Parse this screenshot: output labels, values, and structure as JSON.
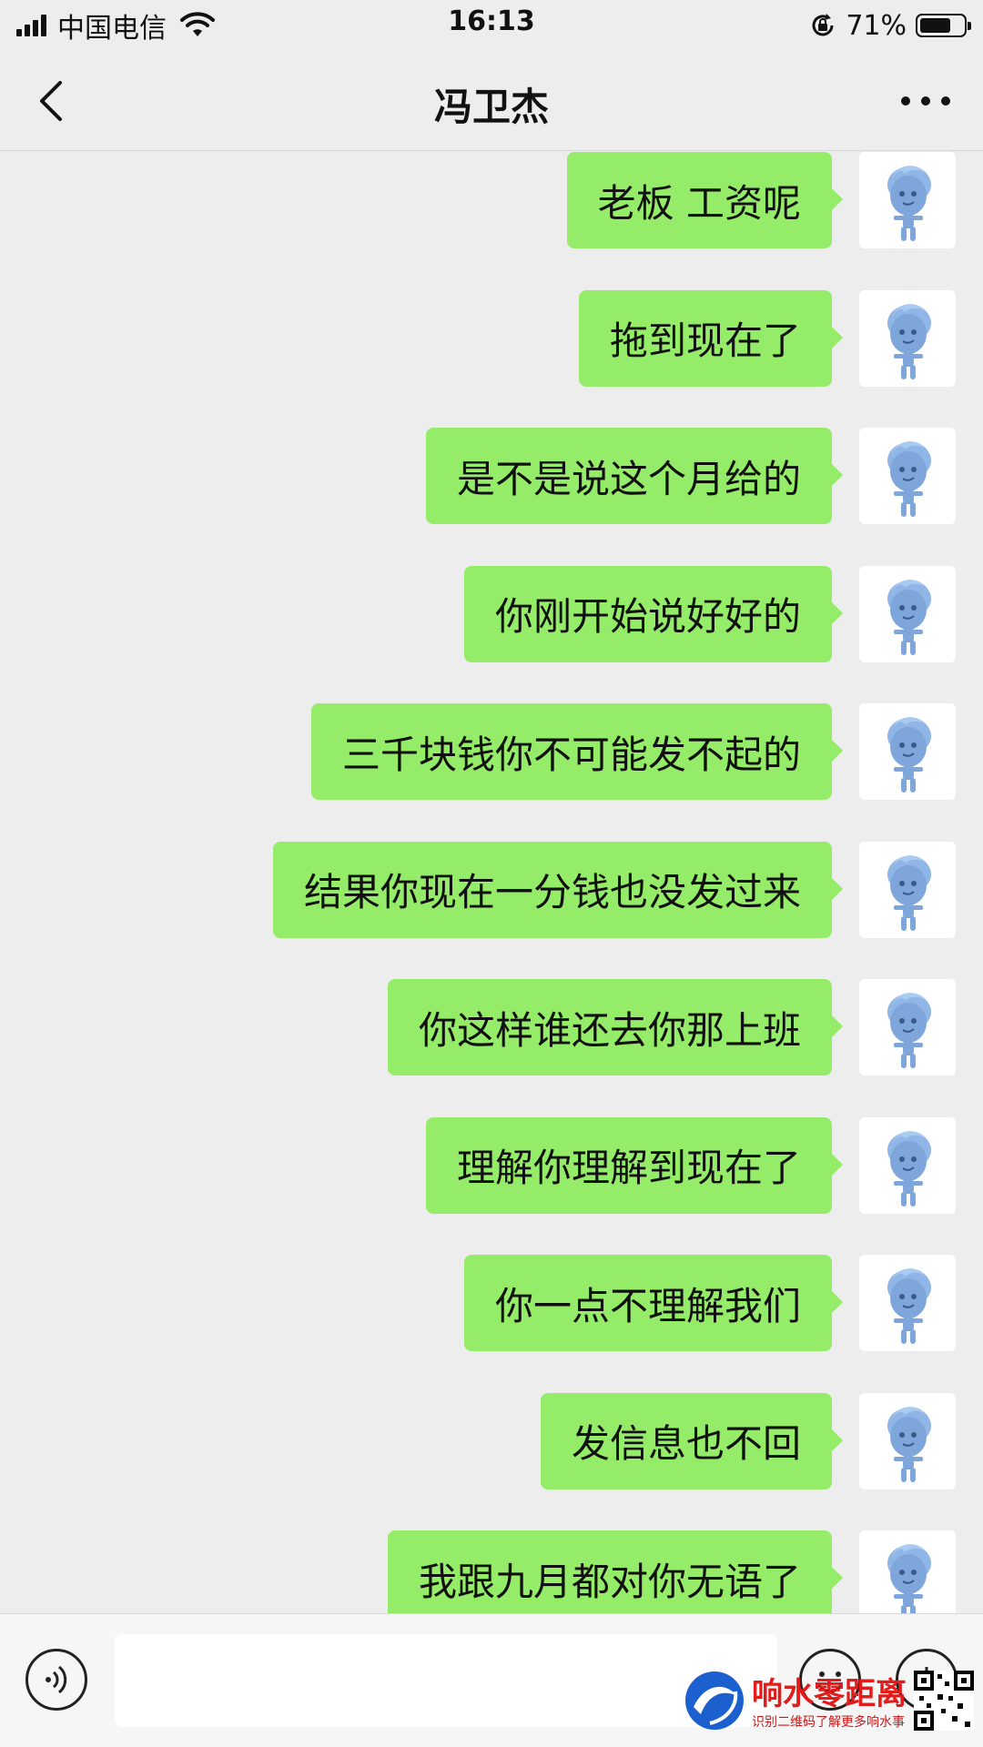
{
  "status_bar": {
    "carrier": "中国电信",
    "time": "16:13",
    "battery_percent": "71%",
    "battery_level": 0.71
  },
  "header": {
    "title": "冯卫杰",
    "back_icon": "chevron-left-icon",
    "more_icon": "more-dots-icon"
  },
  "messages": [
    {
      "text": "老板 工资呢",
      "sender": "me"
    },
    {
      "text": "拖到现在了",
      "sender": "me"
    },
    {
      "text": "是不是说这个月给的",
      "sender": "me"
    },
    {
      "text": "你刚开始说好好的",
      "sender": "me"
    },
    {
      "text": "三千块钱你不可能发不起的",
      "sender": "me"
    },
    {
      "text": "结果你现在一分钱也没发过来",
      "sender": "me"
    },
    {
      "text": "你这样谁还去你那上班",
      "sender": "me"
    },
    {
      "text": "理解你理解到现在了",
      "sender": "me"
    },
    {
      "text": "你一点不理解我们",
      "sender": "me"
    },
    {
      "text": "发信息也不回",
      "sender": "me"
    },
    {
      "text": "我跟九月都对你无语了",
      "sender": "me"
    }
  ],
  "input_bar": {
    "input_value": "",
    "voice_icon": "voice-icon",
    "emoji_icon": "emoji-icon",
    "plus_icon": "plus-icon"
  },
  "watermark": {
    "name": "响水零距离",
    "subtitle": "识别二维码了解更多响水事"
  },
  "colors": {
    "background": "#ededed",
    "bubble": "#95ec69",
    "watermark_red": "#e21b1b"
  }
}
